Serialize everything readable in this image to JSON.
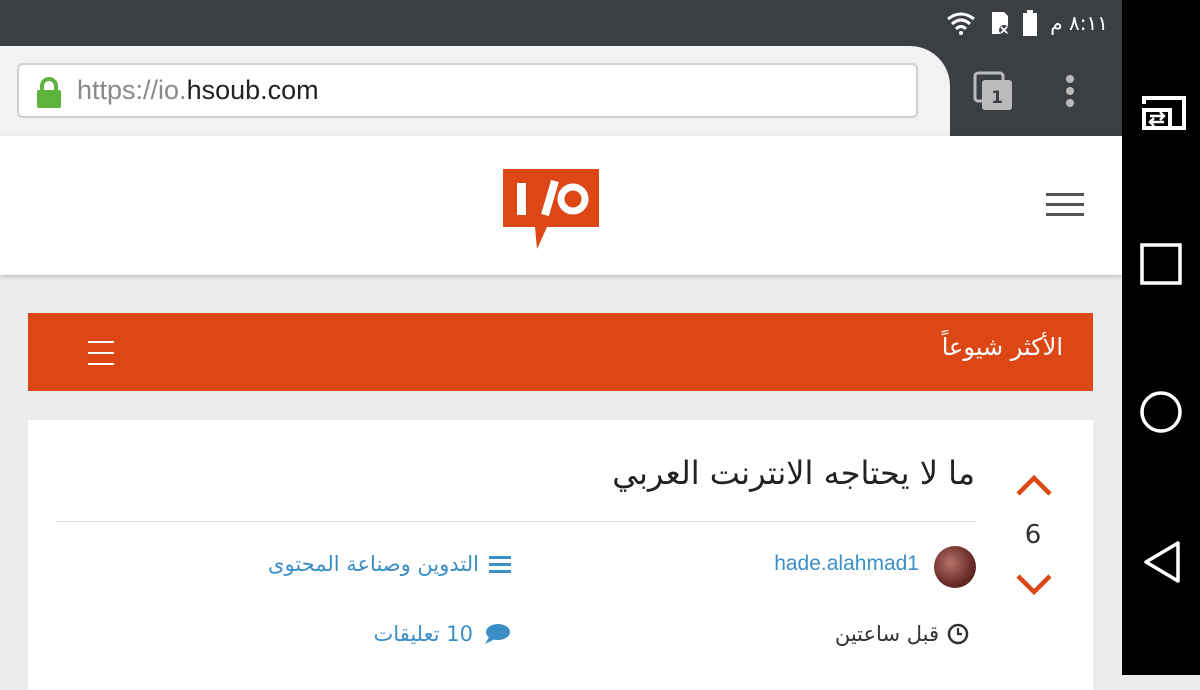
{
  "status_bar": {
    "time": "٨:١١ م",
    "icons": [
      "wifi-icon",
      "sd-card-icon",
      "battery-icon"
    ]
  },
  "browser": {
    "url_scheme": "https://io.",
    "url_domain": "hsoub.com",
    "tab_count": "1",
    "icons": [
      "lock-icon",
      "tabs-icon",
      "overflow-menu-icon"
    ]
  },
  "site": {
    "logo_alt": "I/O",
    "icons": [
      "hamburger-menu-icon"
    ]
  },
  "section": {
    "title": "الأكثر شيوعاً",
    "icons": [
      "section-menu-icon"
    ]
  },
  "post": {
    "title": "ما لا يحتاجه الانترنت العربي",
    "votes": "6",
    "author": "hade.alahmad1",
    "category": "التدوين وصناعة المحتوى",
    "time_ago": "قبل ساعتين",
    "comments": "10 تعليقات",
    "icons": [
      "upvote-icon",
      "downvote-icon",
      "list-icon",
      "clock-icon",
      "comment-icon",
      "avatar"
    ]
  },
  "system_nav": {
    "icons": [
      "cast-icon",
      "recents-icon",
      "home-icon",
      "back-icon"
    ]
  },
  "colors": {
    "brand": "#dc4715",
    "link": "#3a8fc7",
    "status_bar": "#3b3f44"
  }
}
